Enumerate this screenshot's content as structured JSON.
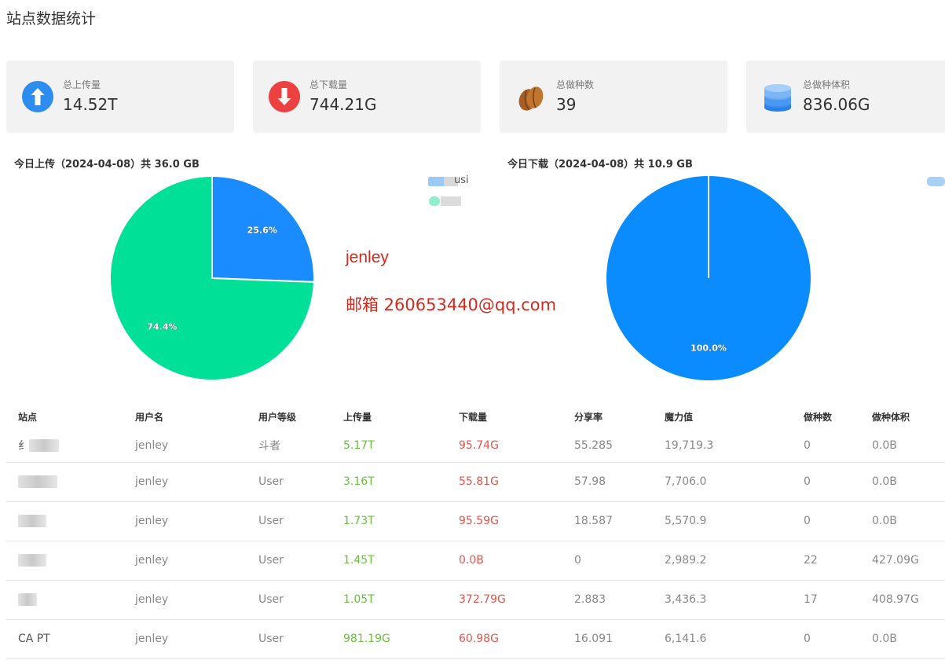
{
  "page": {
    "title": "站点数据统计"
  },
  "stats": [
    {
      "label": "总上传量",
      "value": "14.52T",
      "icon": "upload-arrow-icon",
      "color": "#2d8cf0"
    },
    {
      "label": "总下载量",
      "value": "744.21G",
      "icon": "download-arrow-icon",
      "color": "#ed4040"
    },
    {
      "label": "总做种数",
      "value": "39",
      "icon": "seed-icon",
      "color": "#b0672a"
    },
    {
      "label": "总做种体积",
      "value": "836.06G",
      "icon": "database-icon",
      "color": "#3b8ef0"
    }
  ],
  "chart_data": [
    {
      "type": "pie",
      "title": "今日上传（2024-04-08）共 36.0 GB",
      "legend_partial_text": "usi",
      "slices": [
        {
          "value": 25.6,
          "label": "25.6%",
          "color": "#1a8cff"
        },
        {
          "value": 74.4,
          "label": "74.4%",
          "color": "#00e096"
        }
      ]
    },
    {
      "type": "pie",
      "title": "今日下载（2024-04-08）共 10.9 GB",
      "slices": [
        {
          "value": 100.0,
          "label": "100.0%",
          "color": "#0a8cff"
        }
      ]
    }
  ],
  "watermark": {
    "name": "jenley",
    "email": "邮箱 260653440@qq.com"
  },
  "table": {
    "headers": [
      "站点",
      "用户名",
      "用户等级",
      "上传量",
      "下载量",
      "分享率",
      "魔力值",
      "做种数",
      "做种体积"
    ],
    "rows": [
      {
        "site": "",
        "site_visible": "纟",
        "username": "jenley",
        "level": "斗者",
        "upload": "5.17T",
        "download": "95.74G",
        "ratio": "55.285",
        "bonus": "19,719.3",
        "seeds": "0",
        "seed_size": "0.0B"
      },
      {
        "site": "",
        "site_visible": "",
        "username": "jenley",
        "level": "User",
        "upload": "3.16T",
        "download": "55.81G",
        "ratio": "57.98",
        "bonus": "7,706.0",
        "seeds": "0",
        "seed_size": "0.0B"
      },
      {
        "site": "",
        "site_visible": "",
        "username": "jenley",
        "level": "User",
        "upload": "1.73T",
        "download": "95.59G",
        "ratio": "18.587",
        "bonus": "5,570.9",
        "seeds": "0",
        "seed_size": "0.0B"
      },
      {
        "site": "",
        "site_visible": "",
        "username": "jenley",
        "level": "User",
        "upload": "1.45T",
        "download": "0.0B",
        "ratio": "0",
        "bonus": "2,989.2",
        "seeds": "22",
        "seed_size": "427.09G"
      },
      {
        "site": "",
        "site_visible": "",
        "username": "jenley",
        "level": "User",
        "upload": "1.05T",
        "download": "372.79G",
        "ratio": "2.883",
        "bonus": "3,436.3",
        "seeds": "17",
        "seed_size": "408.97G"
      },
      {
        "site": "",
        "site_visible": "CA  PT",
        "username": "jenley",
        "level": "User",
        "upload": "981.19G",
        "download": "60.98G",
        "ratio": "16.091",
        "bonus": "6,141.6",
        "seeds": "0",
        "seed_size": "0.0B"
      }
    ]
  }
}
